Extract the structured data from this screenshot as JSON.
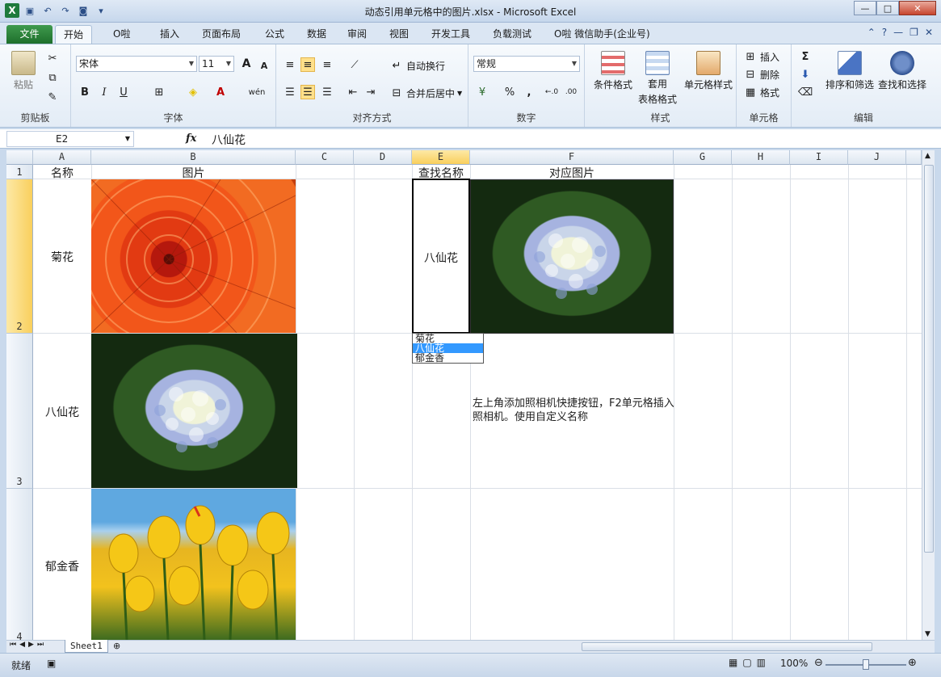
{
  "window": {
    "title": "动态引用单元格中的图片.xlsx - Microsoft Excel",
    "minimize": "—",
    "maximize": "□",
    "close": "✕"
  },
  "ribbon_tabs": [
    {
      "label": "文件"
    },
    {
      "label": "开始"
    },
    {
      "label": "O啦"
    },
    {
      "label": "插入"
    },
    {
      "label": "页面布局"
    },
    {
      "label": "公式"
    },
    {
      "label": "数据"
    },
    {
      "label": "审阅"
    },
    {
      "label": "视图"
    },
    {
      "label": "开发工具"
    },
    {
      "label": "负载测试"
    },
    {
      "label": "O啦 微信助手(企业号)"
    }
  ],
  "ribbon": {
    "clipboard": {
      "paste": "粘贴",
      "label": "剪贴板"
    },
    "font": {
      "name": "宋体",
      "size": "11",
      "label": "字体",
      "grow": "A",
      "shrink": "A",
      "bold": "B",
      "italic": "I",
      "underline": "U",
      "wen": "wén"
    },
    "alignment": {
      "wrap": "自动换行",
      "merge": "合并后居中",
      "label": "对齐方式"
    },
    "number": {
      "format": "常规",
      "percent": "%",
      "comma": ",",
      "label": "数字",
      "inc": "←.0",
      "dec": ".00"
    },
    "styles": {
      "conditional": "条件格式",
      "table_line1": "套用",
      "table_line2": "表格格式",
      "cell_styles": "单元格样式",
      "label": "样式"
    },
    "cells": {
      "insert": "插入",
      "delete": "删除",
      "format": "格式",
      "label": "单元格"
    },
    "editing": {
      "sigma": "Σ",
      "sort": "排序和筛选",
      "find": "查找和选择",
      "label": "编辑"
    }
  },
  "formula_bar": {
    "name_box": "E2",
    "fx": "fx",
    "content": "八仙花"
  },
  "columns": [
    {
      "label": "A",
      "active": false
    },
    {
      "label": "B",
      "active": false
    },
    {
      "label": "C",
      "active": false
    },
    {
      "label": "D",
      "active": false
    },
    {
      "label": "E",
      "active": true
    },
    {
      "label": "F",
      "active": false
    },
    {
      "label": "G",
      "active": false
    },
    {
      "label": "H",
      "active": false
    },
    {
      "label": "I",
      "active": false
    },
    {
      "label": "J",
      "active": false
    }
  ],
  "rows": [
    {
      "label": "1"
    },
    {
      "label": "2"
    },
    {
      "label": "3"
    },
    {
      "label": "4"
    }
  ],
  "cells": {
    "a1": "名称",
    "b1": "图片",
    "e1": "查找名称",
    "f1": "对应图片",
    "a2": "菊花",
    "a3": "八仙花",
    "a4": "郁金香",
    "e2": "八仙花",
    "note": "左上角添加照相机快捷按钮，F2单元格插入照相机。使用自定义名称"
  },
  "dropdown": {
    "options": [
      "菊花",
      "八仙花",
      "郁金香"
    ],
    "selected_index": 1
  },
  "sheet_tabs": [
    {
      "label": "Sheet1"
    }
  ],
  "status": {
    "ready": "就绪",
    "zoom": "100%"
  },
  "colors": {
    "excel_green": "#1e7a3c",
    "selection_highlight": "#3399ff",
    "active_header": "#f9cf5d"
  }
}
